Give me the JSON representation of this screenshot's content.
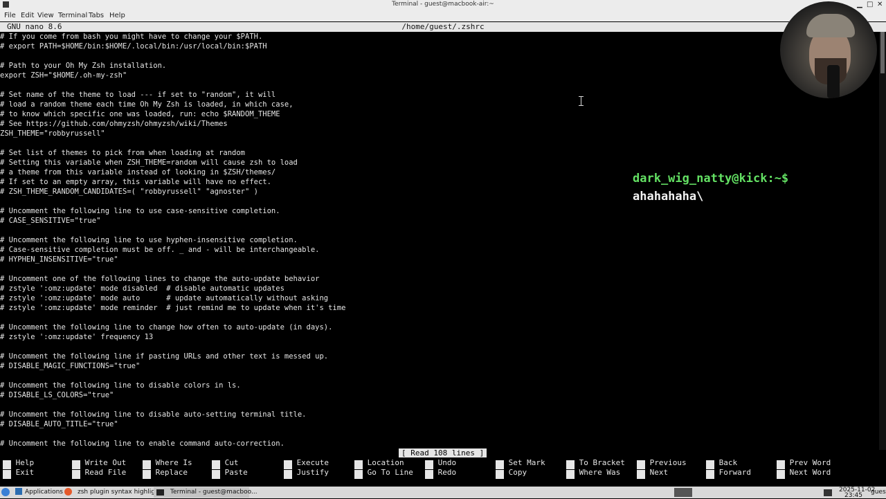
{
  "window": {
    "title": "Terminal - guest@macbook-air:~"
  },
  "menu": [
    "File",
    "Edit",
    "View",
    "Terminal",
    "Tabs",
    "Help"
  ],
  "nano": {
    "version": "GNU nano 8.6",
    "filename": "/home/guest/.zshrc"
  },
  "lines": [
    "# If you come from bash you might have to change your $PATH.",
    "# export PATH=$HOME/bin:$HOME/.local/bin:/usr/local/bin:$PATH",
    "",
    "# Path to your Oh My Zsh installation.",
    "export ZSH=\"$HOME/.oh-my-zsh\"",
    "",
    "# Set name of the theme to load --- if set to \"random\", it will",
    "# load a random theme each time Oh My Zsh is loaded, in which case,",
    "# to know which specific one was loaded, run: echo $RANDOM_THEME",
    "# See https://github.com/ohmyzsh/ohmyzsh/wiki/Themes",
    "ZSH_THEME=\"robbyrussell\"",
    "",
    "# Set list of themes to pick from when loading at random",
    "# Setting this variable when ZSH_THEME=random will cause zsh to load",
    "# a theme from this variable instead of looking in $ZSH/themes/",
    "# If set to an empty array, this variable will have no effect.",
    "# ZSH_THEME_RANDOM_CANDIDATES=( \"robbyrussell\" \"agnoster\" )",
    "",
    "# Uncomment the following line to use case-sensitive completion.",
    "# CASE_SENSITIVE=\"true\"",
    "",
    "# Uncomment the following line to use hyphen-insensitive completion.",
    "# Case-sensitive completion must be off. _ and - will be interchangeable.",
    "# HYPHEN_INSENSITIVE=\"true\"",
    "",
    "# Uncomment one of the following lines to change the auto-update behavior",
    "# zstyle ':omz:update' mode disabled  # disable automatic updates",
    "# zstyle ':omz:update' mode auto      # update automatically without asking",
    "# zstyle ':omz:update' mode reminder  # just remind me to update when it's time",
    "",
    "# Uncomment the following line to change how often to auto-update (in days).",
    "# zstyle ':omz:update' frequency 13",
    "",
    "# Uncomment the following line if pasting URLs and other text is messed up.",
    "# DISABLE_MAGIC_FUNCTIONS=\"true\"",
    "",
    "# Uncomment the following line to disable colors in ls.",
    "# DISABLE_LS_COLORS=\"true\"",
    "",
    "# Uncomment the following line to disable auto-setting terminal title.",
    "# DISABLE_AUTO_TITLE=\"true\"",
    "",
    "# Uncomment the following line to enable command auto-correction."
  ],
  "status": "[ Read 108 lines ]",
  "shortcuts": [
    {
      "key": "^G",
      "label": "Help"
    },
    {
      "key": "^X",
      "label": "Exit"
    },
    {
      "key": "^O",
      "label": "Write Out"
    },
    {
      "key": "^R",
      "label": "Read File"
    },
    {
      "key": "^W",
      "label": "Where Is"
    },
    {
      "key": "^\\",
      "label": "Replace"
    },
    {
      "key": "^K",
      "label": "Cut"
    },
    {
      "key": "^U",
      "label": "Paste"
    },
    {
      "key": "^T",
      "label": "Execute"
    },
    {
      "key": "^J",
      "label": "Justify"
    },
    {
      "key": "^C",
      "label": "Location"
    },
    {
      "key": "^/",
      "label": "Go To Line"
    },
    {
      "key": "M-U",
      "label": "Undo"
    },
    {
      "key": "M-E",
      "label": "Redo"
    },
    {
      "key": "M-A",
      "label": "Set Mark"
    },
    {
      "key": "M-6",
      "label": "Copy"
    },
    {
      "key": "M-]",
      "label": "To Bracket"
    },
    {
      "key": "^B",
      "label": "Where Was"
    },
    {
      "key": "M-Q",
      "label": "Previous"
    },
    {
      "key": "M-W",
      "label": "Next"
    },
    {
      "key": "^B",
      "label": "Back"
    },
    {
      "key": "^F",
      "label": "Forward"
    },
    {
      "key": "^Left",
      "label": "Prev Word"
    },
    {
      "key": "^Right",
      "label": "Next Word"
    }
  ],
  "overlay": {
    "prompt": "dark_wig_natty@kick:~$",
    "message": "ahahahaha\\"
  },
  "taskbar": {
    "apps_label": "Applications",
    "browser_task": "zsh plugin syntax highlighti...",
    "terminal_task": "Terminal - guest@macboo...",
    "date": "2025-11-02",
    "time": "23:45",
    "user": "guest"
  },
  "colors": {
    "prompt": "#63e063",
    "bar": "#e6e6e6",
    "background": "#000000"
  }
}
